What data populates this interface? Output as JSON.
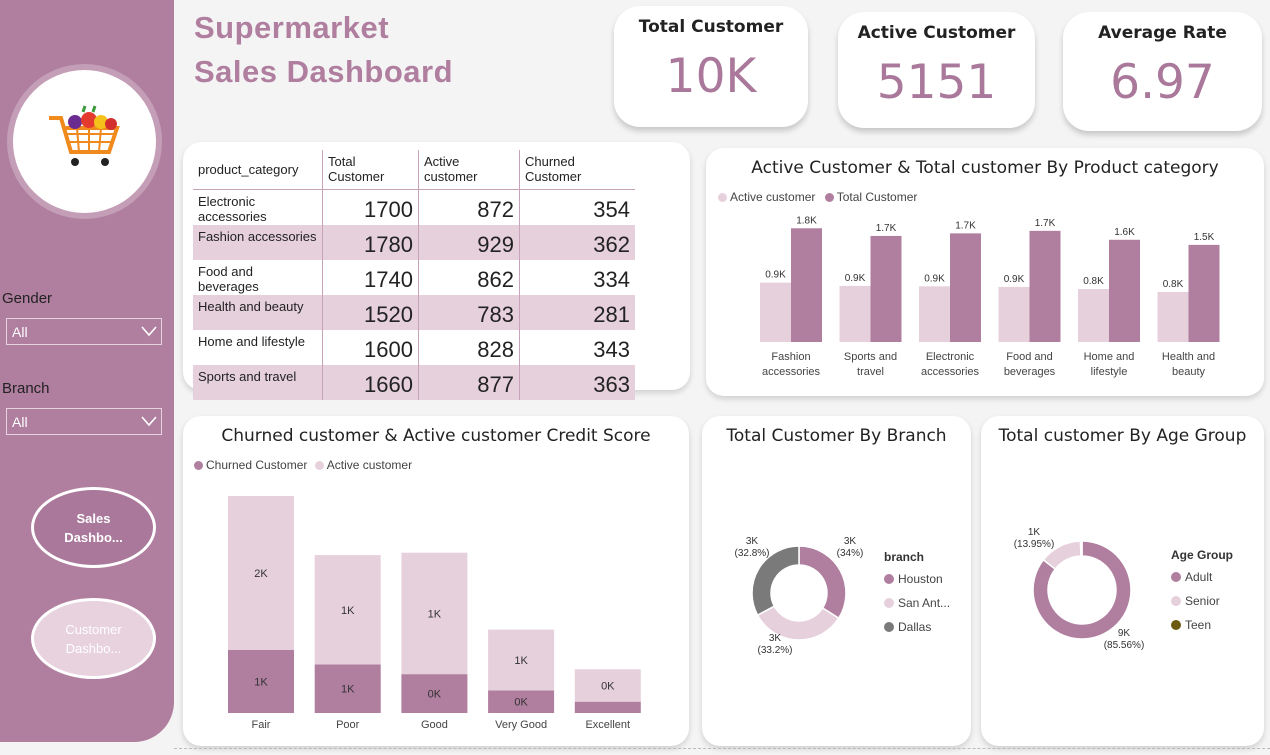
{
  "title": {
    "line1": "Supermarket",
    "line2": "Sales Dashboard"
  },
  "colors": {
    "primary": "#b07e9f",
    "light": "#e6d0dc",
    "dallas": "#7a7a7a",
    "teen": "#6b5a10"
  },
  "sidebar": {
    "logo_icon": "shopping-cart-icon",
    "gender": {
      "label": "Gender",
      "value": "All"
    },
    "branch": {
      "label": "Branch",
      "value": "All"
    },
    "nav": {
      "sales": "Sales\nDashbo...",
      "customer": "Customer\nDashbo..."
    }
  },
  "kpis": [
    {
      "label": "Total Customer",
      "value": "10K"
    },
    {
      "label": "Active Customer",
      "value": "5151"
    },
    {
      "label": "Average Rate",
      "value": "6.97"
    }
  ],
  "table": {
    "headers": [
      "product_category",
      "Total Customer",
      "Active customer",
      "Churned Customer"
    ],
    "rows": [
      {
        "cat": "Electronic accessories",
        "total": "1700",
        "active": "872",
        "churned": "354"
      },
      {
        "cat": "Fashion accessories",
        "total": "1780",
        "active": "929",
        "churned": "362"
      },
      {
        "cat": "Food and beverages",
        "total": "1740",
        "active": "862",
        "churned": "334"
      },
      {
        "cat": "Health and beauty",
        "total": "1520",
        "active": "783",
        "churned": "281"
      },
      {
        "cat": "Home and lifestyle",
        "total": "1600",
        "active": "828",
        "churned": "343"
      },
      {
        "cat": "Sports and travel",
        "total": "1660",
        "active": "877",
        "churned": "363"
      }
    ]
  },
  "chart_data": [
    {
      "type": "bar",
      "title": "Active Customer & Total customer By Product category",
      "categories": [
        "Fashion accessories",
        "Sports and travel",
        "Electronic accessories",
        "Food and beverages",
        "Home and lifestyle",
        "Health and beauty"
      ],
      "category_lines": [
        [
          "Fashion",
          "accessories"
        ],
        [
          "Sports and",
          "travel"
        ],
        [
          "Electronic",
          "accessories"
        ],
        [
          "Food and",
          "beverages"
        ],
        [
          "Home and",
          "lifestyle"
        ],
        [
          "Health and",
          "beauty"
        ]
      ],
      "series": [
        {
          "name": "Active customer",
          "values": [
            929,
            877,
            872,
            862,
            828,
            783
          ],
          "labels": [
            "0.9K",
            "0.9K",
            "0.9K",
            "0.9K",
            "0.8K",
            "0.8K"
          ],
          "color": "#e6d0dc"
        },
        {
          "name": "Total Customer",
          "values": [
            1780,
            1660,
            1700,
            1740,
            1600,
            1520
          ],
          "labels": [
            "1.8K",
            "1.7K",
            "1.7K",
            "1.7K",
            "1.6K",
            "1.5K"
          ],
          "color": "#b07e9f"
        }
      ],
      "legend": "top-left"
    },
    {
      "type": "bar",
      "stacked": true,
      "title": "Churned customer & Active customer Credit Score",
      "categories": [
        "Fair",
        "Poor",
        "Good",
        "Very Good",
        "Excellent"
      ],
      "series": [
        {
          "name": "Churned Customer",
          "values": [
            780,
            600,
            480,
            280,
            140
          ],
          "labels": [
            "1K",
            "1K",
            "0K",
            "0K",
            ""
          ],
          "color": "#b07e9f"
        },
        {
          "name": "Active customer",
          "values": [
            1900,
            1350,
            1500,
            750,
            400
          ],
          "labels": [
            "2K",
            "1K",
            "1K",
            "1K",
            "0K"
          ],
          "color": "#e6d0dc"
        }
      ],
      "legend": "top-left"
    },
    {
      "type": "pie",
      "donut": true,
      "title": "Total Customer By Branch",
      "legend_title": "branch",
      "slices": [
        {
          "name": "Houston",
          "value": 34.0,
          "label": "3K",
          "pct": "(34%)",
          "color": "#b07e9f"
        },
        {
          "name": "San Ant...",
          "value": 33.2,
          "label": "3K",
          "pct": "(33.2%)",
          "color": "#e6d0dc"
        },
        {
          "name": "Dallas",
          "value": 32.8,
          "label": "3K",
          "pct": "(32.8%)",
          "color": "#7a7a7a"
        }
      ]
    },
    {
      "type": "pie",
      "donut": true,
      "title": "Total customer By Age Group",
      "legend_title": "Age Group",
      "slices": [
        {
          "name": "Adult",
          "value": 85.56,
          "label": "9K",
          "pct": "(85.56%)",
          "color": "#b07e9f"
        },
        {
          "name": "Senior",
          "value": 13.95,
          "label": "1K",
          "pct": "(13.95%)",
          "color": "#e6d0dc"
        },
        {
          "name": "Teen",
          "value": 0.49,
          "label": "",
          "pct": "",
          "color": "#6b5a10"
        }
      ]
    }
  ]
}
